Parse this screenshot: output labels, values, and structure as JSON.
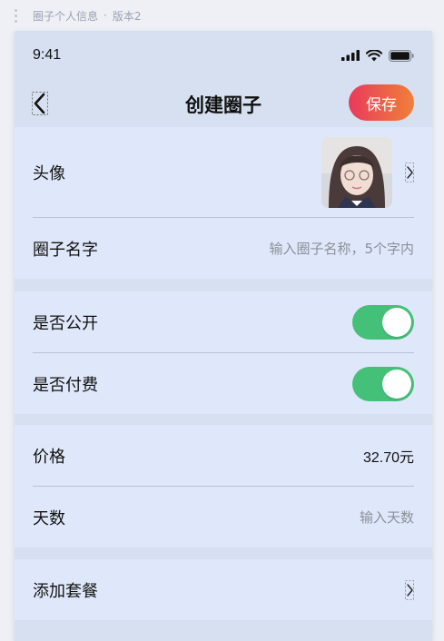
{
  "canvas": {
    "breadcrumb_page": "圈子个人信息",
    "separator": "·",
    "breadcrumb_version": "版本2"
  },
  "status_bar": {
    "time": "9:41"
  },
  "nav": {
    "title": "创建圈子",
    "save_label": "保存"
  },
  "form": {
    "avatar_label": "头像",
    "name_label": "圈子名字",
    "name_placeholder": "输入圈子名称，5个字内",
    "public_label": "是否公开",
    "public_on": true,
    "paid_label": "是否付费",
    "paid_on": true,
    "price_label": "价格",
    "price_value": "32.70元",
    "days_label": "天数",
    "days_placeholder": "输入天数",
    "package_label": "添加套餐"
  },
  "colors": {
    "save_gradient_start": "#e93a5c",
    "save_gradient_end": "#f0803a",
    "toggle_on": "#45c079"
  }
}
